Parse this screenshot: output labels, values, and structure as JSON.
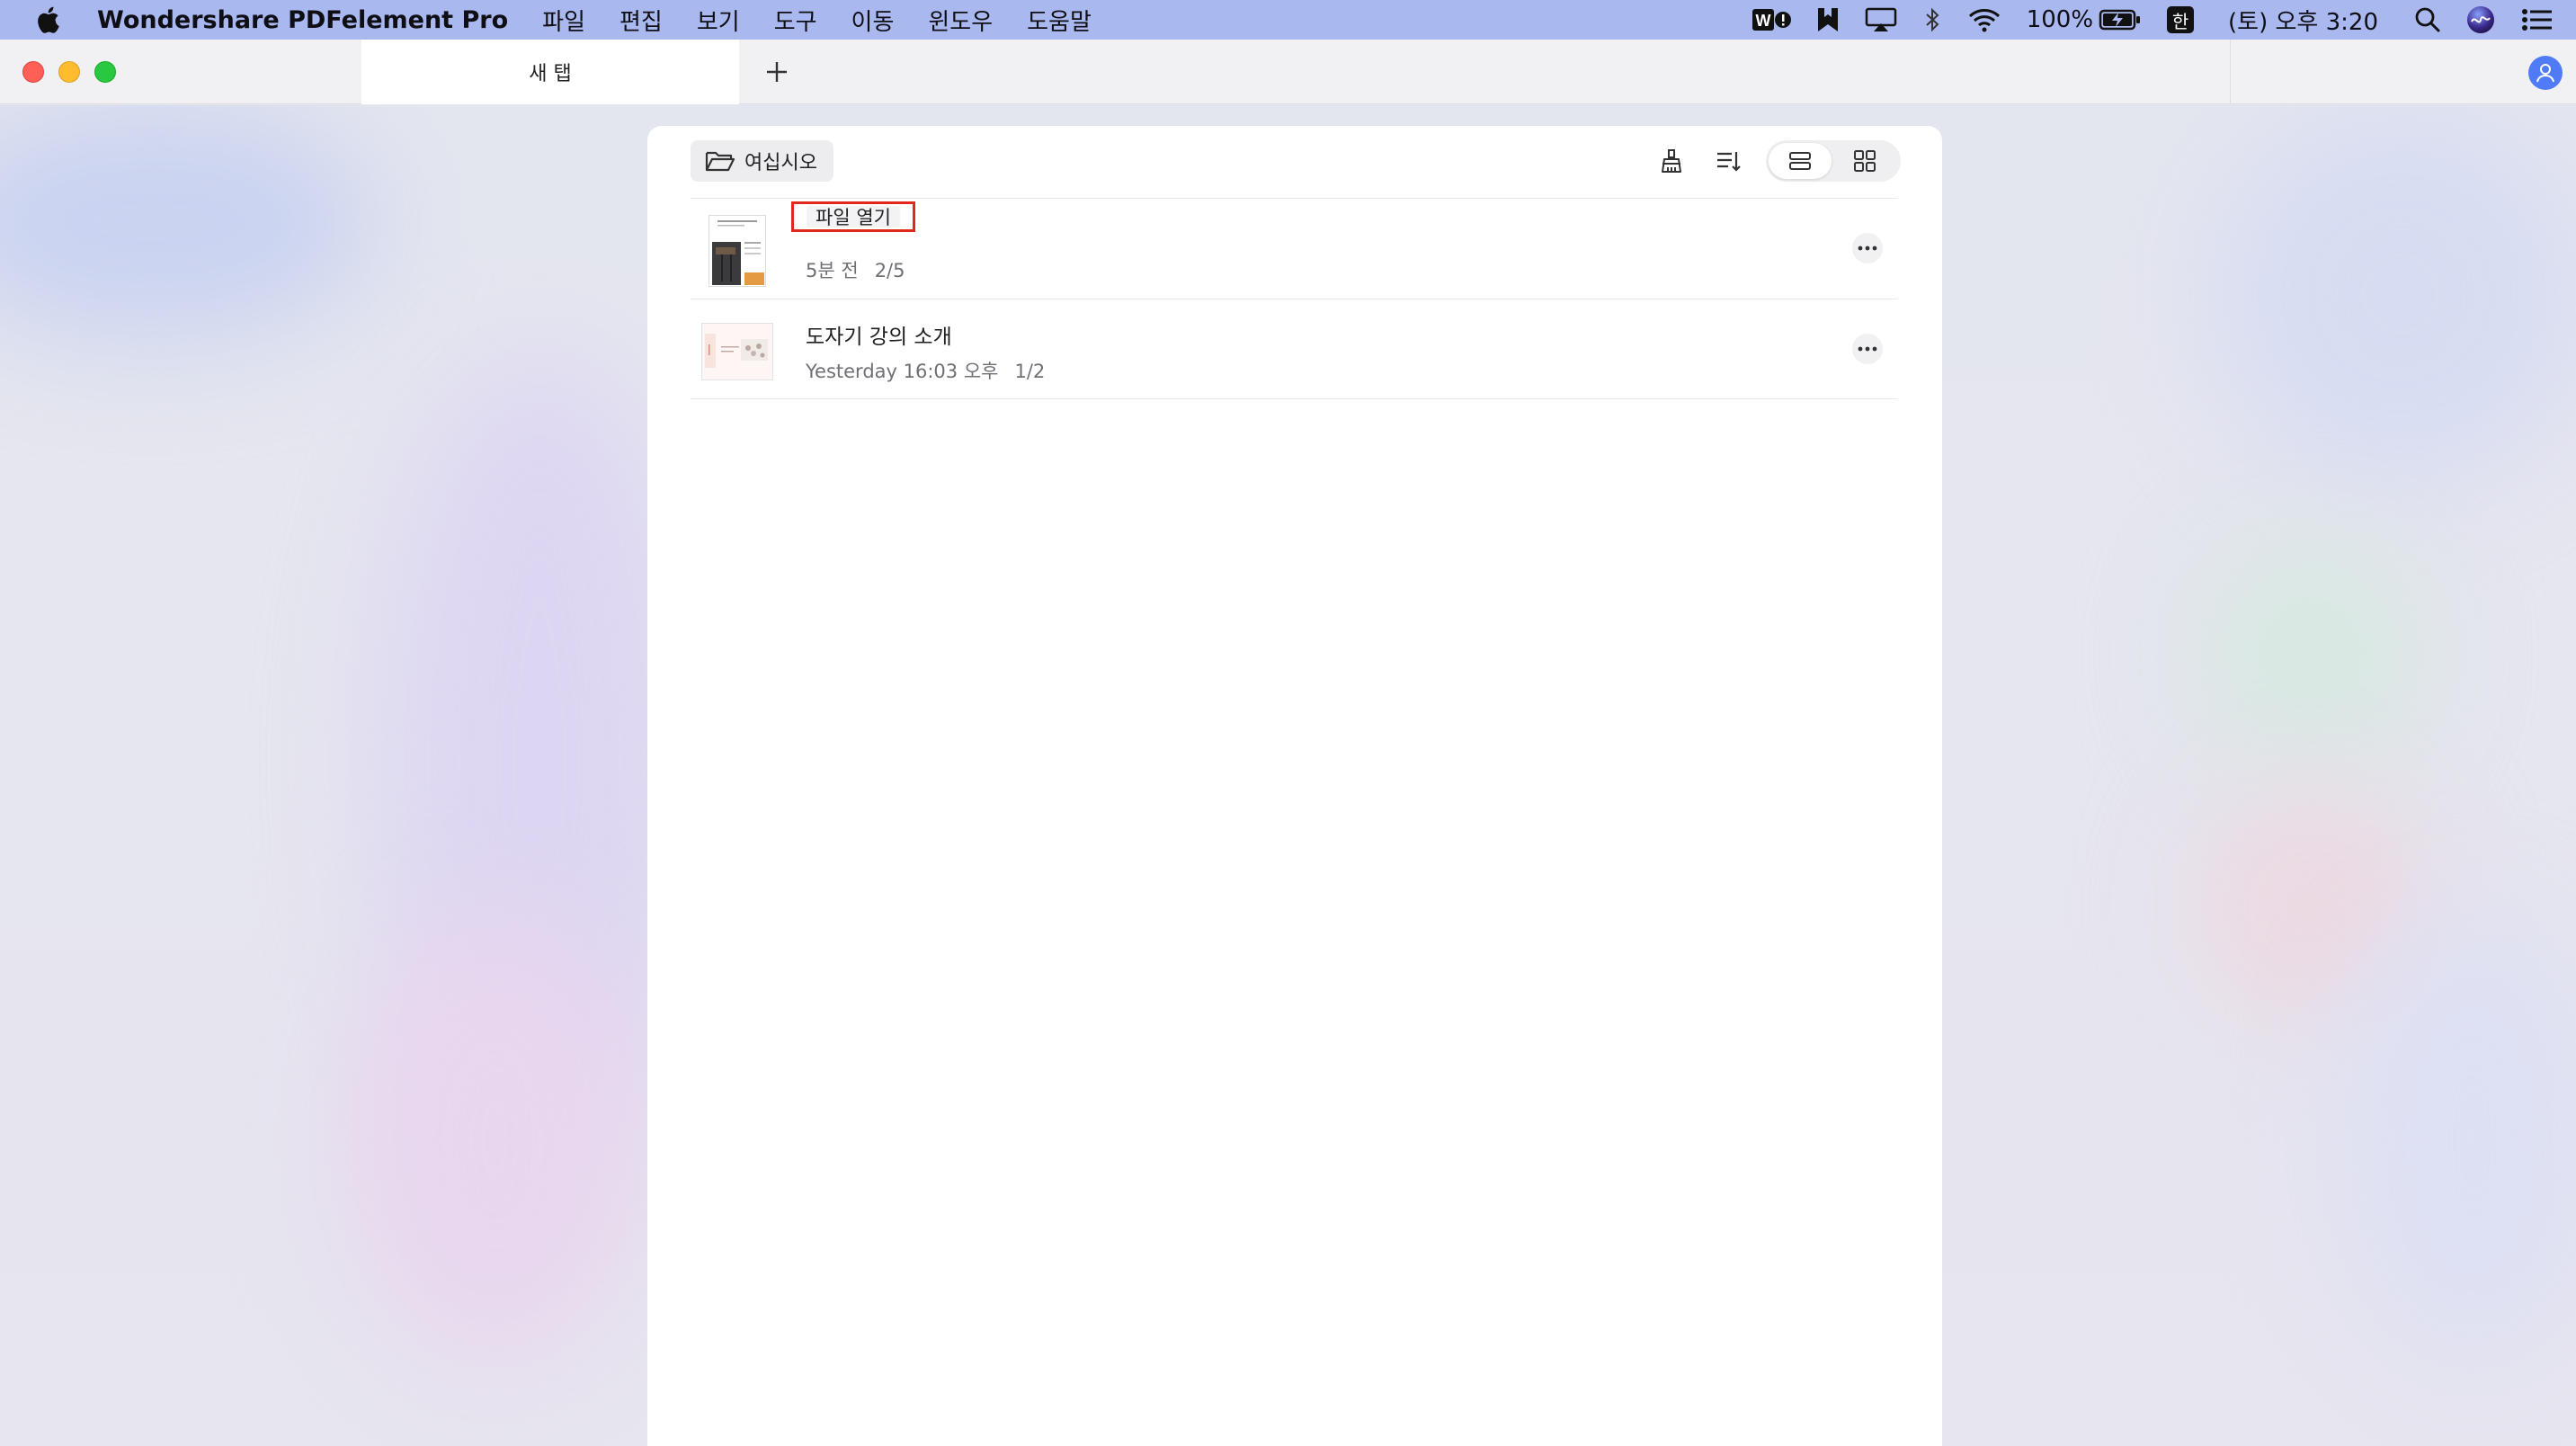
{
  "menubar": {
    "app_name": "Wondershare PDFelement Pro",
    "items": [
      "파일",
      "편집",
      "보기",
      "도구",
      "이동",
      "윈도우",
      "도움말"
    ],
    "battery": "100%",
    "input_method": "한",
    "clock": "(토) 오후 3:20"
  },
  "tabs": {
    "active_label": "새 탭"
  },
  "toolbar": {
    "open_label": "여십시오"
  },
  "tooltip": {
    "label": "파일 열기"
  },
  "files": [
    {
      "name": "",
      "time": "5분 전",
      "pages": "2/5"
    },
    {
      "name": "도자기 강의 소개",
      "time": "Yesterday 16:03 오후",
      "pages": "1/2"
    }
  ],
  "icons": {
    "apple": "apple-logo-icon",
    "folder": "folder-open-icon",
    "cleanup": "broom-icon",
    "sort": "sort-icon",
    "list_view": "list-view-icon",
    "grid_view": "grid-view-icon",
    "more": "more-horizontal-icon",
    "account": "user-account-icon"
  },
  "colors": {
    "menubar": "#a9b8ee",
    "tooltip_highlight": "#e0291c",
    "account": "#4f7cf6"
  }
}
